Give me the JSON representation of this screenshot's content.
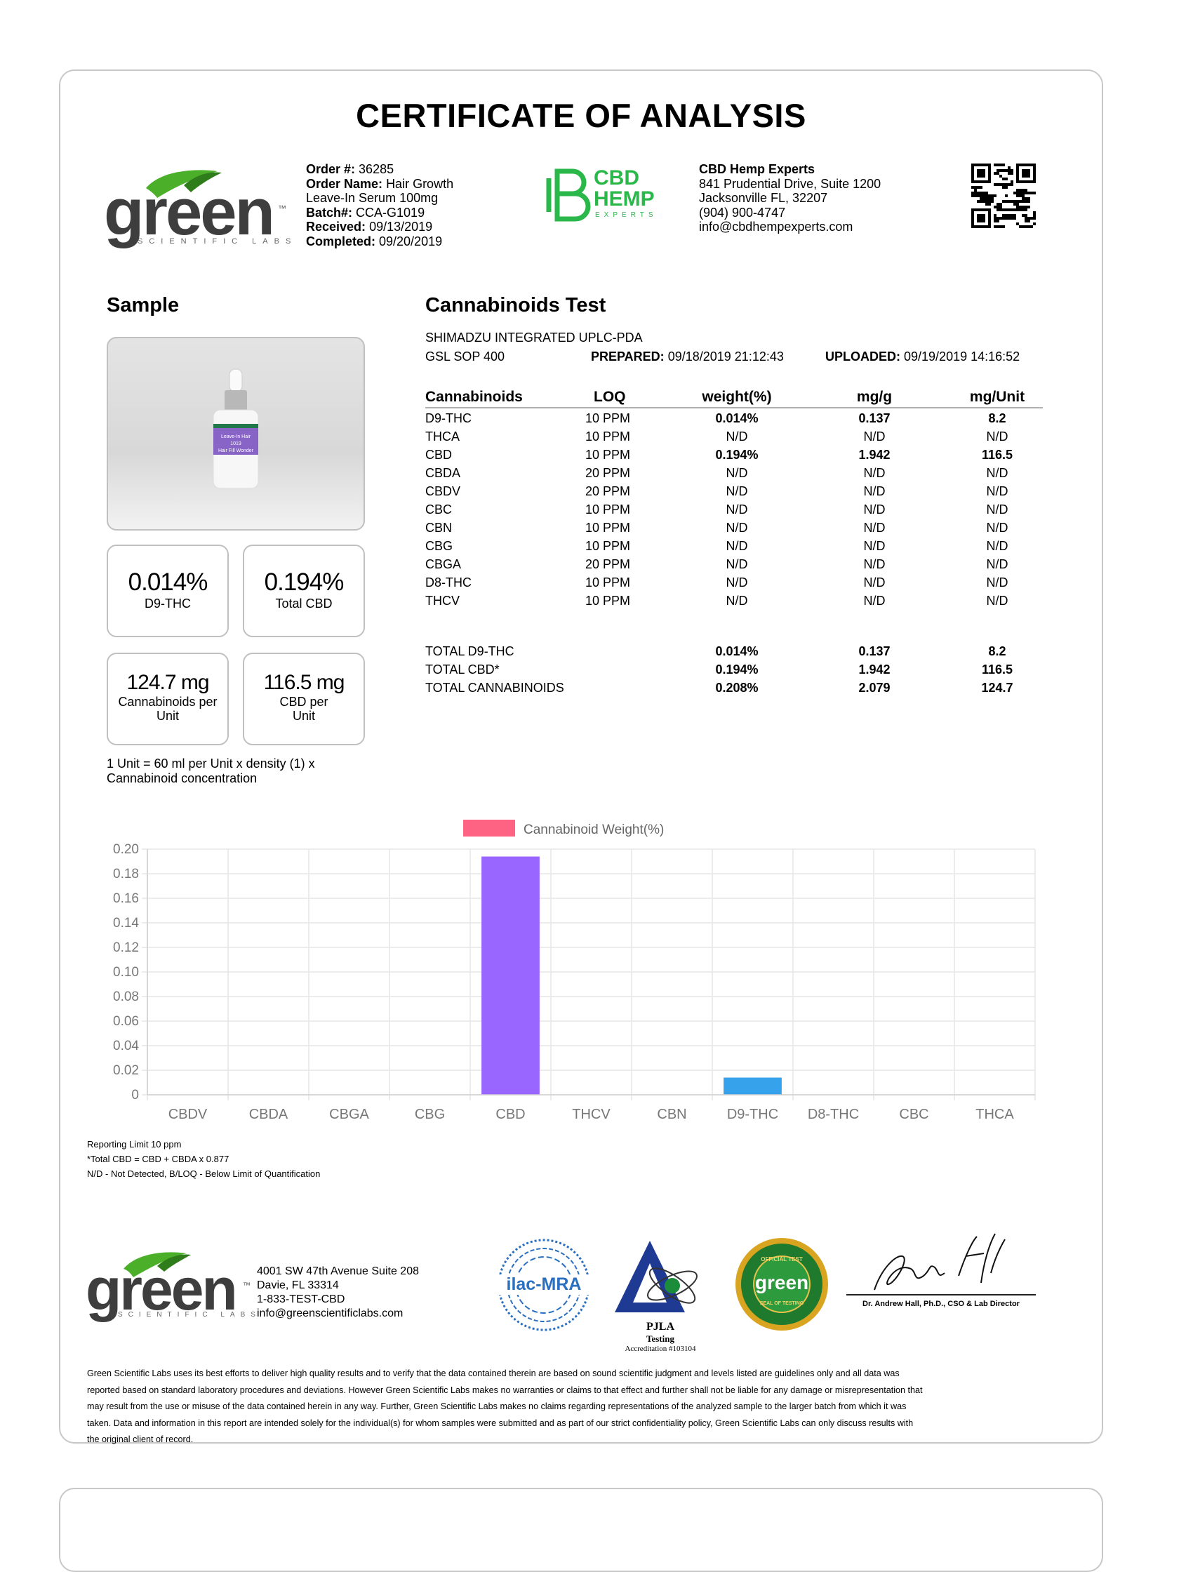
{
  "title": "CERTIFICATE OF ANALYSIS",
  "lab_logo": {
    "word": "green",
    "sub": "SCIENTIFIC LABS",
    "tm": "™"
  },
  "order": {
    "order_no_label": "Order #:",
    "order_no": "36285",
    "order_name_label": "Order Name:",
    "order_name_1": "Hair Growth",
    "order_name_2": "Leave-In Serum 100mg",
    "batch_label": "Batch#:",
    "batch": "CCA-G1019",
    "received_label": "Received:",
    "received": "09/13/2019",
    "completed_label": "Completed:",
    "completed": "09/20/2019"
  },
  "client_logo": {
    "line1": "CBD",
    "line2": "HEMP",
    "line3": "EXPERTS"
  },
  "client": {
    "name": "CBD Hemp Experts",
    "address1": "841 Prudential Drive, Suite 1200",
    "address2": "Jacksonville FL, 32207",
    "phone": "(904) 900-4747",
    "email": "info@cbdhempexperts.com"
  },
  "sample": {
    "heading": "Sample",
    "bottle_label": "Leave-In Hair 1019 Hair Fill Wonder"
  },
  "stats": [
    {
      "value": "0.014%",
      "label": "D9-THC"
    },
    {
      "value": "0.194%",
      "label": "Total CBD"
    },
    {
      "value": "124.7 mg",
      "label1": "Cannabinoids per",
      "label2": "Unit"
    },
    {
      "value": "116.5 mg",
      "label1": "CBD per",
      "label2": "Unit"
    }
  ],
  "unit_note_1": "1 Unit = 60 ml per Unit x density (1) x",
  "unit_note_2": "Cannabinoid concentration",
  "test": {
    "heading": "Cannabinoids Test",
    "method": "SHIMADZU INTEGRATED UPLC-PDA",
    "sop": "GSL SOP 400",
    "prepared_label": "PREPARED:",
    "prepared": "09/18/2019 21:12:43",
    "uploaded_label": "UPLOADED:",
    "uploaded": "09/19/2019 14:16:52",
    "headers": [
      "Cannabinoids",
      "LOQ",
      "weight(%)",
      "mg/g",
      "mg/Unit"
    ],
    "rows": [
      {
        "name": "D9-THC",
        "loq": "10 PPM",
        "w": "0.014%",
        "mg": "0.137",
        "unit": "8.2"
      },
      {
        "name": "THCA",
        "loq": "10 PPM",
        "w": "N/D",
        "mg": "N/D",
        "unit": "N/D"
      },
      {
        "name": "CBD",
        "loq": "10 PPM",
        "w": "0.194%",
        "mg": "1.942",
        "unit": "116.5"
      },
      {
        "name": "CBDA",
        "loq": "20 PPM",
        "w": "N/D",
        "mg": "N/D",
        "unit": "N/D"
      },
      {
        "name": "CBDV",
        "loq": "20 PPM",
        "w": "N/D",
        "mg": "N/D",
        "unit": "N/D"
      },
      {
        "name": "CBC",
        "loq": "10 PPM",
        "w": "N/D",
        "mg": "N/D",
        "unit": "N/D"
      },
      {
        "name": "CBN",
        "loq": "10 PPM",
        "w": "N/D",
        "mg": "N/D",
        "unit": "N/D"
      },
      {
        "name": "CBG",
        "loq": "10 PPM",
        "w": "N/D",
        "mg": "N/D",
        "unit": "N/D"
      },
      {
        "name": "CBGA",
        "loq": "20 PPM",
        "w": "N/D",
        "mg": "N/D",
        "unit": "N/D"
      },
      {
        "name": "D8-THC",
        "loq": "10 PPM",
        "w": "N/D",
        "mg": "N/D",
        "unit": "N/D"
      },
      {
        "name": "THCV",
        "loq": "10 PPM",
        "w": "N/D",
        "mg": "N/D",
        "unit": "N/D"
      }
    ],
    "totals": [
      {
        "name": "TOTAL D9-THC",
        "w": "0.014%",
        "mg": "0.137",
        "unit": "8.2"
      },
      {
        "name": "TOTAL CBD*",
        "w": "0.194%",
        "mg": "1.942",
        "unit": "116.5"
      },
      {
        "name": "TOTAL CANNABINOIDS",
        "w": "0.208%",
        "mg": "2.079",
        "unit": "124.7"
      }
    ]
  },
  "chart_data": {
    "type": "bar",
    "legend": "Cannabinoid Weight(%)",
    "legend_color": "#ff6384",
    "categories": [
      "CBDV",
      "CBDA",
      "CBGA",
      "CBG",
      "CBD",
      "THCV",
      "CBN",
      "D9-THC",
      "D8-THC",
      "CBC",
      "THCA"
    ],
    "values": [
      0,
      0,
      0,
      0,
      0.194,
      0,
      0,
      0.014,
      0,
      0,
      0
    ],
    "colors": {
      "CBD": "#9966ff",
      "D9-THC": "#36a2eb"
    },
    "ylim": [
      0,
      0.2
    ],
    "yticks": [
      "0.20",
      "0.18",
      "0.16",
      "0.14",
      "0.12",
      "0.10",
      "0.08",
      "0.06",
      "0.04",
      "0.02",
      "0"
    ],
    "grid": true
  },
  "footnotes": [
    "Reporting Limit 10 ppm",
    "*Total CBD = CBD + CBDA x 0.877",
    "N/D - Not Detected, B/LOQ - Below Limit of Quantification"
  ],
  "lab_contact": {
    "address1": "4001 SW 47th Avenue Suite 208",
    "address2": "Davie, FL 33314",
    "phone": "1-833-TEST-CBD",
    "email": "info@greenscientificlabs.com"
  },
  "accreditation": {
    "ilac": "ilac-MRA",
    "pjla": "PJLA",
    "pjla_sub": "Testing",
    "pjla_acc": "Accreditation #103104",
    "seal_top": "OFFICIAL TEST",
    "seal_word": "green",
    "seal_bottom": "SEAL OF TESTING"
  },
  "signature": {
    "name": "Dr. Andrew Hall, Ph.D., CSO & Lab Director"
  },
  "disclaimer": [
    "Green Scientific Labs uses its best efforts to deliver high quality results and to verify that the data contained therein are based on sound scientific judgment and levels listed are guidelines only and all data was",
    "reported based on standard laboratory procedures and deviations. However Green Scientific Labs makes no warranties or claims to that effect and further shall not be liable for any damage or misrepresentation that",
    "may result from the use or misuse of the data contained herein in any way. Further, Green Scientific Labs makes no claims regarding representations of the analyzed sample to the larger batch from which it was",
    "taken. Data and information in this report are intended solely for the individual(s) for whom samples were submitted and as part of our strict confidentiality policy, Green Scientific Labs can only discuss results with",
    "the original client of record."
  ]
}
